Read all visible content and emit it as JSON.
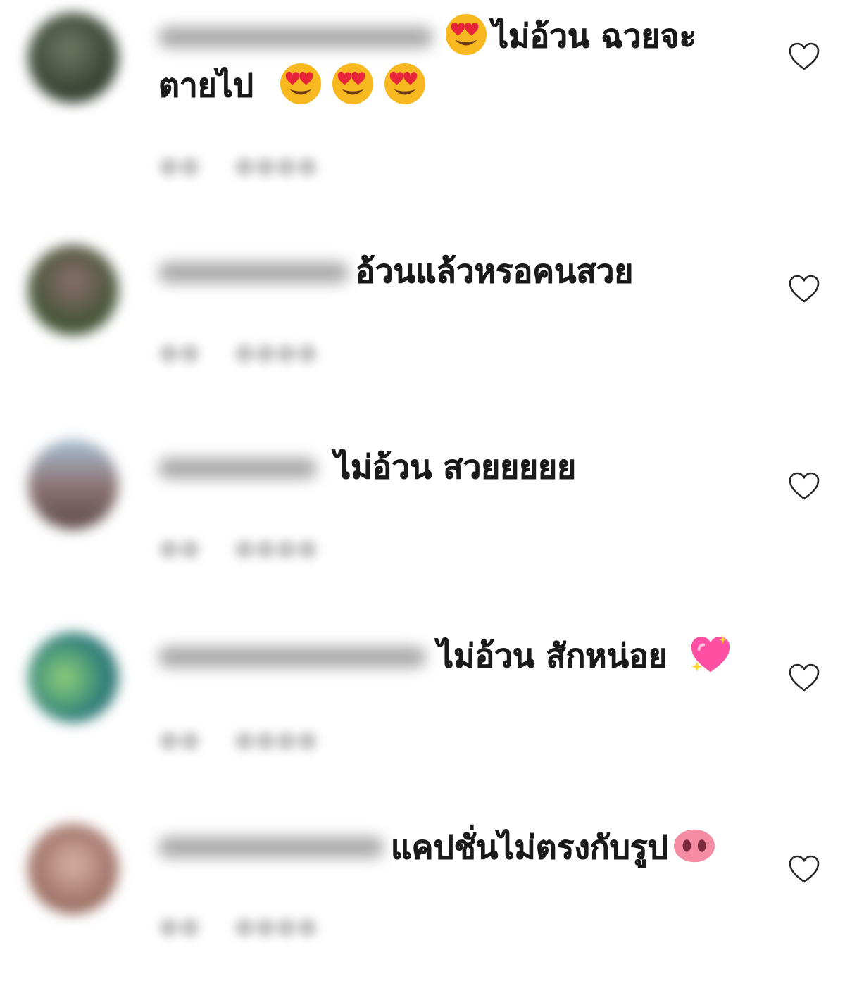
{
  "comments": [
    {
      "text_line1": "ไม่อ้วน ฉวยจะ",
      "text_line2": "ตายไป",
      "leading_emoji": "heart-eyes-emoji",
      "trailing_emojis": [
        "heart-eyes-emoji",
        "heart-eyes-emoji",
        "heart-eyes-emoji"
      ],
      "avatar_color": "#3e4b3a"
    },
    {
      "text_line1": "อ้วนแล้วหรอคนสวย",
      "avatar_color": "#4a5a3c"
    },
    {
      "text_line1": "ไม่อ้วน สวยยยยย",
      "avatar_color": "#7d6a6a"
    },
    {
      "text_line1": "ไม่อ้วน สักหน่อย",
      "trailing_emoji": "sparkling-heart-emoji",
      "avatar_color": "#4f8a76"
    },
    {
      "text_line1": "แคปชั่นไม่ตรงกับรูป",
      "trailing_emoji": "pig-nose-emoji",
      "avatar_color": "#b48a80"
    }
  ],
  "colors": {
    "text": "#1a1a1a",
    "muted": "#8e8e8e",
    "heart_outline": "#262626",
    "emoji_face": "#f7b820",
    "emoji_heart": "#e8243b",
    "sparkle_heart": "#ff4fa3",
    "pig_nose": "#f48ca4"
  }
}
